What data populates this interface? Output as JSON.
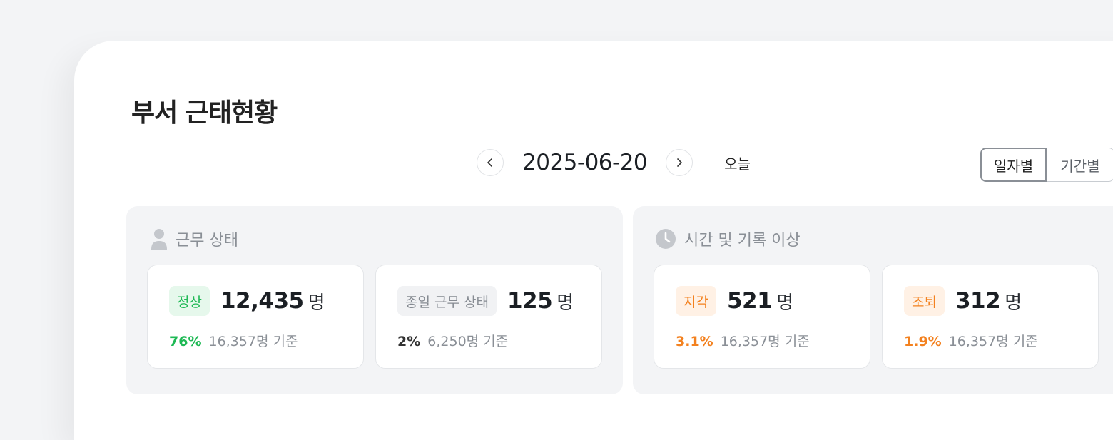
{
  "page": {
    "title": "부서 근태현황"
  },
  "date_nav": {
    "date": "2025-06-20",
    "today_label": "오늘"
  },
  "view_toggle": {
    "options": [
      "일자별",
      "기간별"
    ],
    "selected": "일자별"
  },
  "panels": [
    {
      "title": "근무 상태",
      "icon": "person-icon",
      "stats": [
        {
          "badge": "정상",
          "value": "12,435",
          "unit": "명",
          "percent": "76%",
          "basis": "16,357명 기준",
          "color": "#1fb955"
        },
        {
          "badge": "종일 근무 상태",
          "value": "125",
          "unit": "명",
          "percent": "2%",
          "basis": "6,250명 기준",
          "color": "#333333"
        }
      ]
    },
    {
      "title": "시간 및 기록 이상",
      "icon": "clock-icon",
      "stats": [
        {
          "badge": "지각",
          "value": "521",
          "unit": "명",
          "percent": "3.1%",
          "basis": "16,357명 기준",
          "color": "#f3811f"
        },
        {
          "badge": "조퇴",
          "value": "312",
          "unit": "명",
          "percent": "1.9%",
          "basis": "16,357명 기준",
          "color": "#f3811f"
        }
      ]
    }
  ]
}
